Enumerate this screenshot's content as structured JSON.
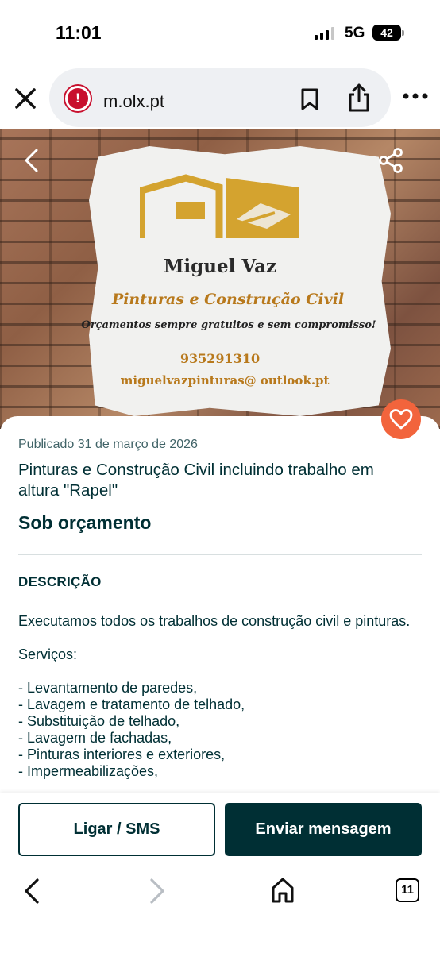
{
  "status_bar": {
    "time": "11:01",
    "network": "5G",
    "battery": "42"
  },
  "browser": {
    "url": "m.olx.pt",
    "tab_count": "11"
  },
  "listing_image": {
    "name": "Miguel Vaz",
    "subtitle": "Pinturas e Construção Civil",
    "tagline": "Orçamentos sempre gratuitos e sem compromisso!",
    "phone": "935291310",
    "email": "miguelvazpinturas@ outlook.pt"
  },
  "listing": {
    "published": "Publicado 31 de março de 2026",
    "title": "Pinturas e Construção Civil incluindo trabalho em altura \"Rapel\"",
    "price": "Sob orçamento",
    "description_heading": "DESCRIÇÃO",
    "description_intro": "Executamos todos os trabalhos de construção civil e pinturas.",
    "services_label": "Serviços:",
    "services": [
      "- Levantamento de paredes,",
      "- Lavagem e tratamento de telhado,",
      "- Substituição de telhado,",
      "- Lavagem de fachadas,",
      "- Pinturas interiores e exteriores,",
      "- Impermeabilizações,"
    ]
  },
  "actions": {
    "call_label": "Ligar / SMS",
    "message_label": "Enviar mensagem"
  },
  "colors": {
    "brand_dark": "#002f34",
    "favorite": "#f2643c",
    "warning": "#c8102e"
  }
}
